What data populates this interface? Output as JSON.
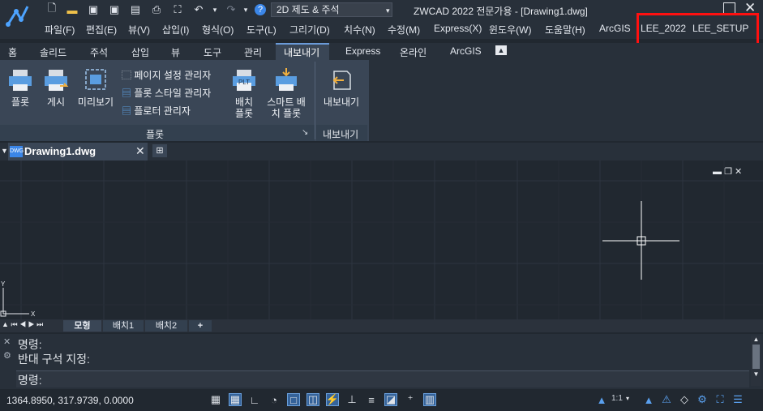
{
  "window": {
    "title": "ZWCAD 2022 전문가용 - [Drawing1.dwg]"
  },
  "quick_access": {
    "workspace": "2D 제도 & 주석"
  },
  "menu": [
    "파일(F)",
    "편집(E)",
    "뷰(V)",
    "삽입(I)",
    "형식(O)",
    "도구(L)",
    "그리기(D)",
    "치수(N)",
    "수정(M)",
    "Express(X)",
    "윈도우(W)",
    "도움말(H)",
    "ArcGIS",
    "LEE_2022",
    "LEE_SETUP"
  ],
  "ribbon_tabs": [
    "홈",
    "솔리드",
    "주석",
    "삽입",
    "뷰",
    "도구",
    "관리",
    "내보내기",
    "Express",
    "온라인",
    "ArcGIS"
  ],
  "ribbon": {
    "plot": "플롯",
    "publish": "게시",
    "preview": "미리보기",
    "page_setup": "페이지 설정 관리자",
    "plot_style": "플롯 스타일 관리자",
    "plotter": "플로터 관리자",
    "batch_plot_1": "배치",
    "batch_plot_2": "플롯",
    "plt_badge": "PLT",
    "smart_plot_1": "스마트 배",
    "smart_plot_2": "치 플롯",
    "export": "내보내기",
    "panel_plot": "플롯",
    "panel_export": "내보내기"
  },
  "document_tab": "Drawing1.dwg",
  "doc_icon_text": "DWG",
  "layout_tabs": [
    "모형",
    "배치1",
    "배치2",
    "+"
  ],
  "axis": {
    "x": "X",
    "y": "Y"
  },
  "command": {
    "line1": "명령:",
    "line2": "반대 구석 지정:",
    "prompt": "명령:"
  },
  "status": {
    "coords": "1364.8950, 317.9739, 0.0000",
    "scale": "1:1"
  },
  "colors": {
    "accent": "#6a9ad8",
    "highlight_box": "#ff1010"
  }
}
